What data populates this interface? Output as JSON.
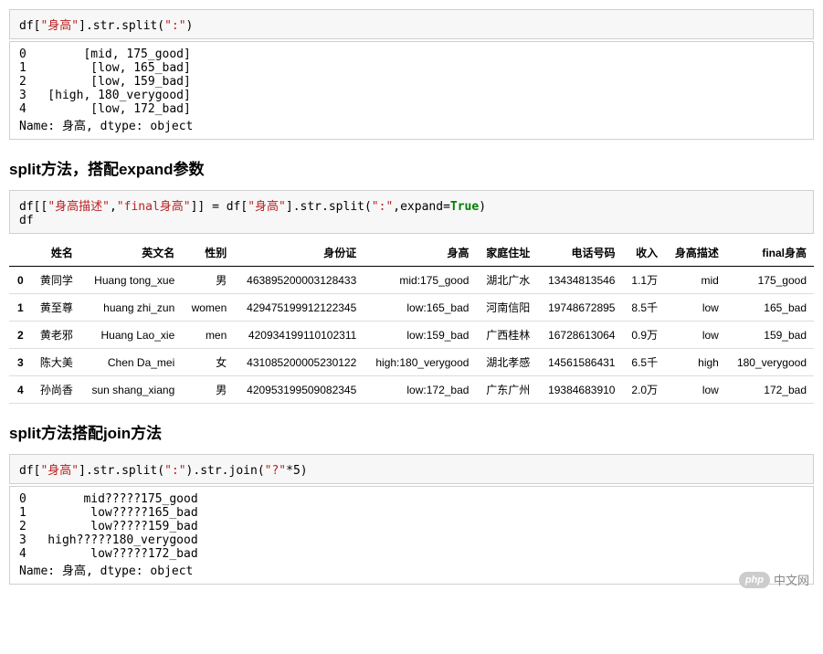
{
  "cell1": {
    "code_parts": {
      "p0": "df[",
      "p1": "\"身高\"",
      "p2": "].str.split(",
      "p3": "\":\"",
      "p4": ")"
    },
    "output": "0        [mid, 175_good]\n1         [low, 165_bad]\n2         [low, 159_bad]\n3   [high, 180_verygood]\n4         [low, 172_bad]\nName: 身高, dtype: object"
  },
  "heading1": "split方法，搭配expand参数",
  "cell2": {
    "code_parts": {
      "p0": "df[[",
      "p1": "\"身高描述\"",
      "p2": ",",
      "p3": "\"final身高\"",
      "p4": "]] = df[",
      "p5": "\"身高\"",
      "p6": "].str.split(",
      "p7": "\":\"",
      "p8": ",expand=",
      "p9": "True",
      "p10": ")\ndf"
    }
  },
  "table": {
    "headers": [
      "",
      "姓名",
      "英文名",
      "性别",
      "身份证",
      "身高",
      "家庭住址",
      "电话号码",
      "收入",
      "身高描述",
      "final身高"
    ],
    "rows": [
      [
        "0",
        "黄同学",
        "Huang tong_xue",
        "男",
        "463895200003128433",
        "mid:175_good",
        "湖北广水",
        "13434813546",
        "1.1万",
        "mid",
        "175_good"
      ],
      [
        "1",
        "黄至尊",
        "huang zhi_zun",
        "women",
        "429475199912122345",
        "low:165_bad",
        "河南信阳",
        "19748672895",
        "8.5千",
        "low",
        "165_bad"
      ],
      [
        "2",
        "黄老邪",
        "Huang Lao_xie",
        "men",
        "420934199110102311",
        "low:159_bad",
        "广西桂林",
        "16728613064",
        "0.9万",
        "low",
        "159_bad"
      ],
      [
        "3",
        "陈大美",
        "Chen Da_mei",
        "女",
        "431085200005230122",
        "high:180_verygood",
        "湖北孝感",
        "14561586431",
        "6.5千",
        "high",
        "180_verygood"
      ],
      [
        "4",
        "孙尚香",
        "sun shang_xiang",
        "男",
        "420953199509082345",
        "low:172_bad",
        "广东广州",
        "19384683910",
        "2.0万",
        "low",
        "172_bad"
      ]
    ]
  },
  "heading2": "split方法搭配join方法",
  "cell3": {
    "code_parts": {
      "p0": "df[",
      "p1": "\"身高\"",
      "p2": "].str.split(",
      "p3": "\":\"",
      "p4": ").str.join(",
      "p5": "\"?\"",
      "p6": "*",
      "p7": "5",
      "p8": ")"
    },
    "output": "0        mid?????175_good\n1         low?????165_bad\n2         low?????159_bad\n3   high?????180_verygood\n4         low?????172_bad\nName: 身高, dtype: object"
  },
  "watermark": {
    "badge": "php",
    "text": "中文网"
  }
}
